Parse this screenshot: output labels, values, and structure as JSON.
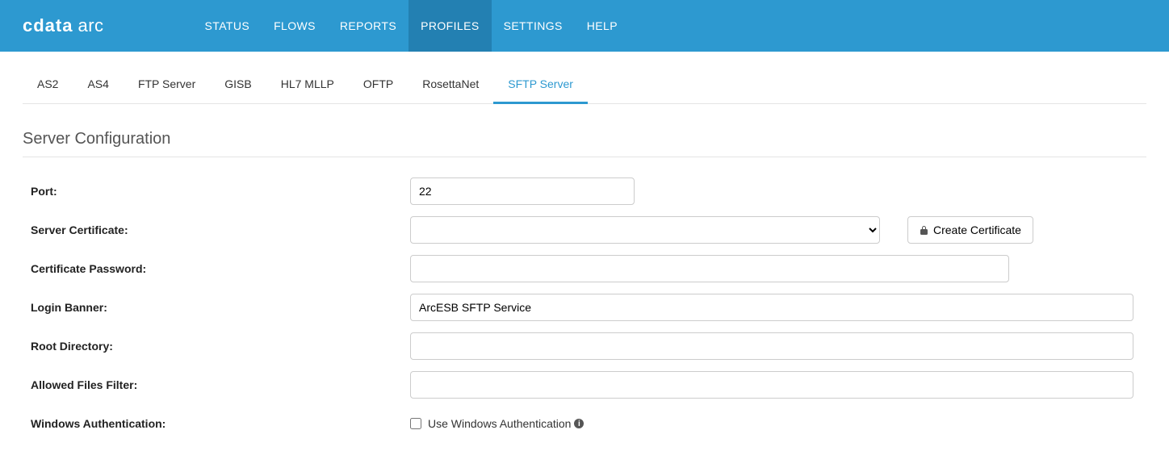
{
  "brand": {
    "main": "cdata",
    "sub": "arc"
  },
  "nav": {
    "items": [
      {
        "label": "STATUS"
      },
      {
        "label": "FLOWS"
      },
      {
        "label": "REPORTS"
      },
      {
        "label": "PROFILES",
        "active": true
      },
      {
        "label": "SETTINGS"
      },
      {
        "label": "HELP"
      }
    ]
  },
  "subtabs": [
    {
      "label": "AS2"
    },
    {
      "label": "AS4"
    },
    {
      "label": "FTP Server"
    },
    {
      "label": "GISB"
    },
    {
      "label": "HL7 MLLP"
    },
    {
      "label": "OFTP"
    },
    {
      "label": "RosettaNet"
    },
    {
      "label": "SFTP Server",
      "active": true
    }
  ],
  "section_title": "Server Configuration",
  "form": {
    "port_label": "Port:",
    "port_value": "22",
    "server_cert_label": "Server Certificate:",
    "server_cert_value": "",
    "create_cert_label": "Create Certificate",
    "cert_password_label": "Certificate Password:",
    "cert_password_value": "",
    "login_banner_label": "Login Banner:",
    "login_banner_value": "ArcESB SFTP Service",
    "root_dir_label": "Root Directory:",
    "root_dir_value": "",
    "allowed_filter_label": "Allowed Files Filter:",
    "allowed_filter_value": "",
    "win_auth_label": "Windows Authentication:",
    "win_auth_checkbox_label": "Use Windows Authentication"
  }
}
